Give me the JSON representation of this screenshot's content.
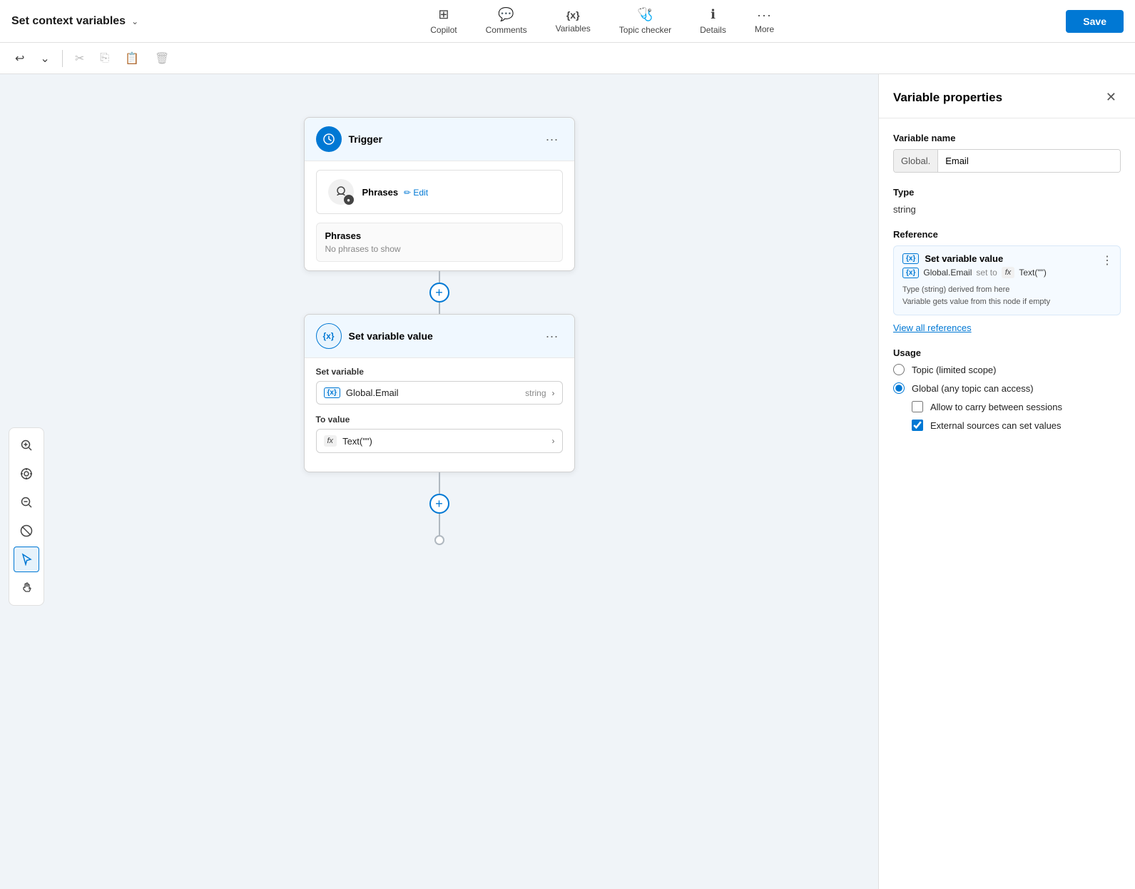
{
  "topbar": {
    "title": "Set context variables",
    "nav_items": [
      {
        "id": "copilot",
        "label": "Copilot",
        "icon": "⊞"
      },
      {
        "id": "comments",
        "label": "Comments",
        "icon": "💬"
      },
      {
        "id": "variables",
        "label": "Variables",
        "icon": "{x}"
      },
      {
        "id": "topic_checker",
        "label": "Topic checker",
        "icon": "🩺"
      },
      {
        "id": "details",
        "label": "Details",
        "icon": "ℹ"
      },
      {
        "id": "more",
        "label": "More",
        "icon": "···"
      }
    ],
    "save_label": "Save"
  },
  "toolbar": {
    "undo": "↩",
    "redo_chevron": "⌄",
    "cut": "✂",
    "copy": "⎘",
    "paste": "📋",
    "delete": "🗑"
  },
  "flow": {
    "trigger_node": {
      "title": "Trigger",
      "phrases_label": "Phrases",
      "edit_label": "Edit",
      "phrases_title": "Phrases",
      "phrases_empty": "No phrases to show"
    },
    "set_var_node": {
      "title": "Set variable value",
      "set_variable_label": "Set variable",
      "var_badge": "{x}",
      "var_name": "Global.Email",
      "var_type": "string",
      "to_value_label": "To value",
      "fx_badge": "fx",
      "fx_value": "Text(\"\")"
    }
  },
  "left_tools": [
    {
      "id": "zoom-in",
      "icon": "🔍+",
      "symbol": "+🔍"
    },
    {
      "id": "center",
      "icon": "◎"
    },
    {
      "id": "zoom-out",
      "icon": "🔍-"
    },
    {
      "id": "block",
      "icon": "⊘"
    },
    {
      "id": "cursor",
      "icon": "↖",
      "active": true
    },
    {
      "id": "hand",
      "icon": "✋"
    }
  ],
  "right_panel": {
    "title": "Variable properties",
    "close_icon": "✕",
    "var_name_label": "Variable name",
    "var_prefix": "Global.",
    "var_value": "Email",
    "type_label": "Type",
    "type_value": "string",
    "reference_label": "Reference",
    "ref_title": "Set variable value",
    "ref_badge": "{x}",
    "ref_var": "Global.Email",
    "ref_set_to": "set to",
    "ref_fx_badge": "fx",
    "ref_fx_value": "Text(\"\")",
    "ref_note_line1": "Type (string) derived from here",
    "ref_note_line2": "Variable gets value from this node if empty",
    "view_refs_label": "View all references",
    "usage_label": "Usage",
    "usage_options": [
      {
        "id": "topic",
        "label": "Topic (limited scope)",
        "checked": false
      },
      {
        "id": "global",
        "label": "Global (any topic can access)",
        "checked": true
      }
    ],
    "checkboxes": [
      {
        "id": "carry",
        "label": "Allow to carry between sessions",
        "checked": false
      },
      {
        "id": "external",
        "label": "External sources can set values",
        "checked": true
      }
    ]
  }
}
